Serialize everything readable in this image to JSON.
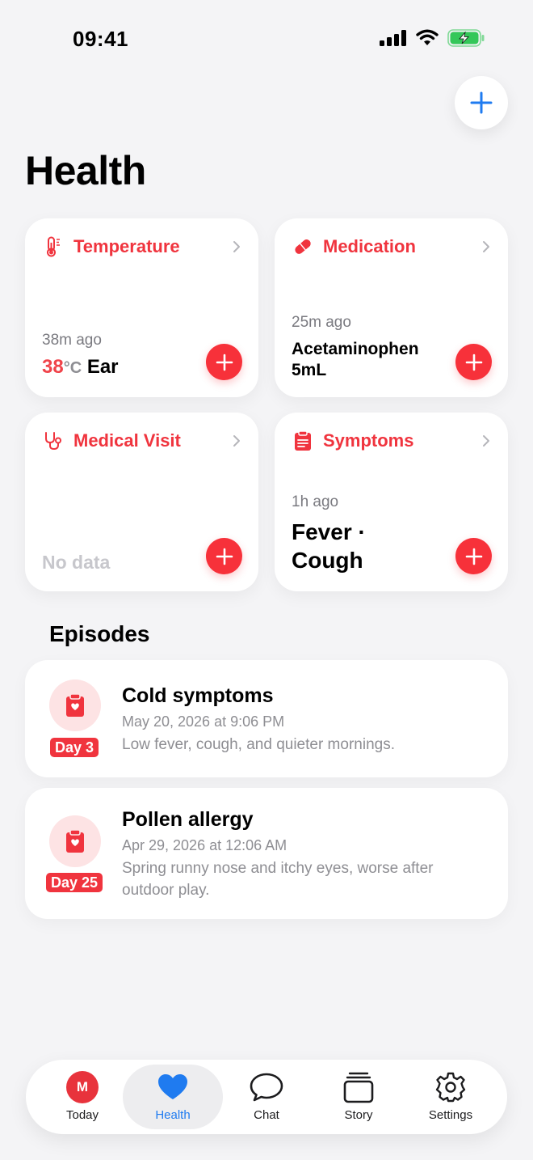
{
  "status_bar": {
    "time": "09:41"
  },
  "header": {
    "title": "Health"
  },
  "cards": {
    "temperature": {
      "title": "Temperature",
      "ago": "38m ago",
      "value": "38",
      "unit": "°C",
      "site": "Ear"
    },
    "medication": {
      "title": "Medication",
      "ago": "25m ago",
      "name": "Acetaminophen",
      "dose": "5mL"
    },
    "medical_visit": {
      "title": "Medical Visit",
      "empty": "No data"
    },
    "symptoms": {
      "title": "Symptoms",
      "ago": "1h ago",
      "line1": "Fever ·",
      "line2": "Cough"
    }
  },
  "episodes": {
    "title": "Episodes",
    "items": [
      {
        "title": "Cold symptoms",
        "date": "May 20, 2026 at 9:06 PM",
        "description": "Low fever, cough, and quieter mornings.",
        "badge": "Day 3"
      },
      {
        "title": "Pollen allergy",
        "date": "Apr 29, 2026 at 12:06 AM",
        "description": "Spring runny nose and itchy eyes, worse after outdoor play.",
        "badge": "Day 25"
      }
    ]
  },
  "tab_bar": {
    "avatar_initial": "M",
    "items": [
      {
        "label": "Today"
      },
      {
        "label": "Health"
      },
      {
        "label": "Chat"
      },
      {
        "label": "Story"
      },
      {
        "label": "Settings"
      }
    ]
  },
  "colors": {
    "accent_red": "#F0343E",
    "accent_blue": "#1F7BF0",
    "background": "#F4F4F6"
  }
}
